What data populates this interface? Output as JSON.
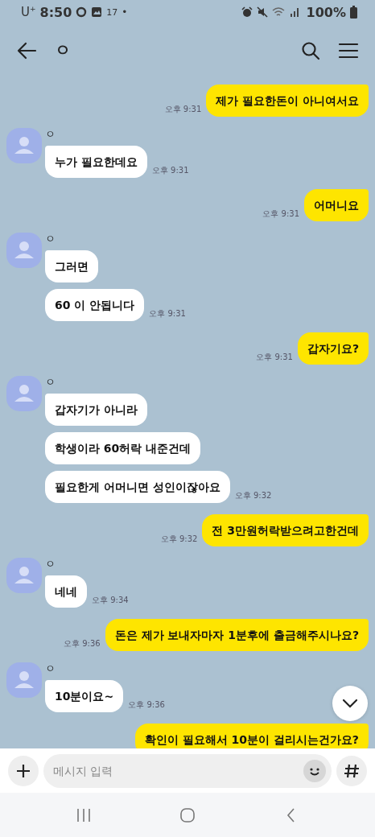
{
  "status_bar": {
    "carrier": "U$^{+}$",
    "time": "8:50",
    "temperature": "17",
    "dot": "•",
    "battery": "100%"
  },
  "header": {
    "title": "ㅇ"
  },
  "messages": [
    {
      "kind": "sent",
      "texts": [
        "제가 필요한돈이 아니여서요"
      ],
      "time": "오후 9:31"
    },
    {
      "kind": "received",
      "sender": "ㅇ",
      "texts": [
        "누가 필요한데요"
      ],
      "time": "오후 9:31"
    },
    {
      "kind": "sent",
      "texts": [
        "어머니요"
      ],
      "time": "오후 9:31"
    },
    {
      "kind": "received",
      "sender": "ㅇ",
      "texts": [
        "그러면",
        "60 이 안됩니다"
      ],
      "time": "오후 9:31"
    },
    {
      "kind": "sent",
      "texts": [
        "갑자기요?"
      ],
      "time": "오후 9:31"
    },
    {
      "kind": "received",
      "sender": "ㅇ",
      "texts": [
        "갑자기가 아니라",
        "학생이라 60허락 내준건데",
        "필요한게 어머니면 성인이잖아요"
      ],
      "time": "오후 9:32"
    },
    {
      "kind": "sent",
      "texts": [
        "전 3만원허락받으려고한건데"
      ],
      "time": "오후 9:32"
    },
    {
      "kind": "received",
      "sender": "ㅇ",
      "texts": [
        "네네"
      ],
      "time": "오후 9:34"
    },
    {
      "kind": "sent",
      "texts": [
        "돈은 제가 보내자마자 1분후에 출금해주시나요?"
      ],
      "time": "오후 9:36"
    },
    {
      "kind": "received",
      "sender": "ㅇ",
      "texts": [
        "10분이요~"
      ],
      "time": "오후 9:36"
    },
    {
      "kind": "sent",
      "texts": [
        "확인이 필요해서 10분이 걸리시는건가요?"
      ]
    }
  ],
  "input": {
    "placeholder": "메시지 입력"
  }
}
